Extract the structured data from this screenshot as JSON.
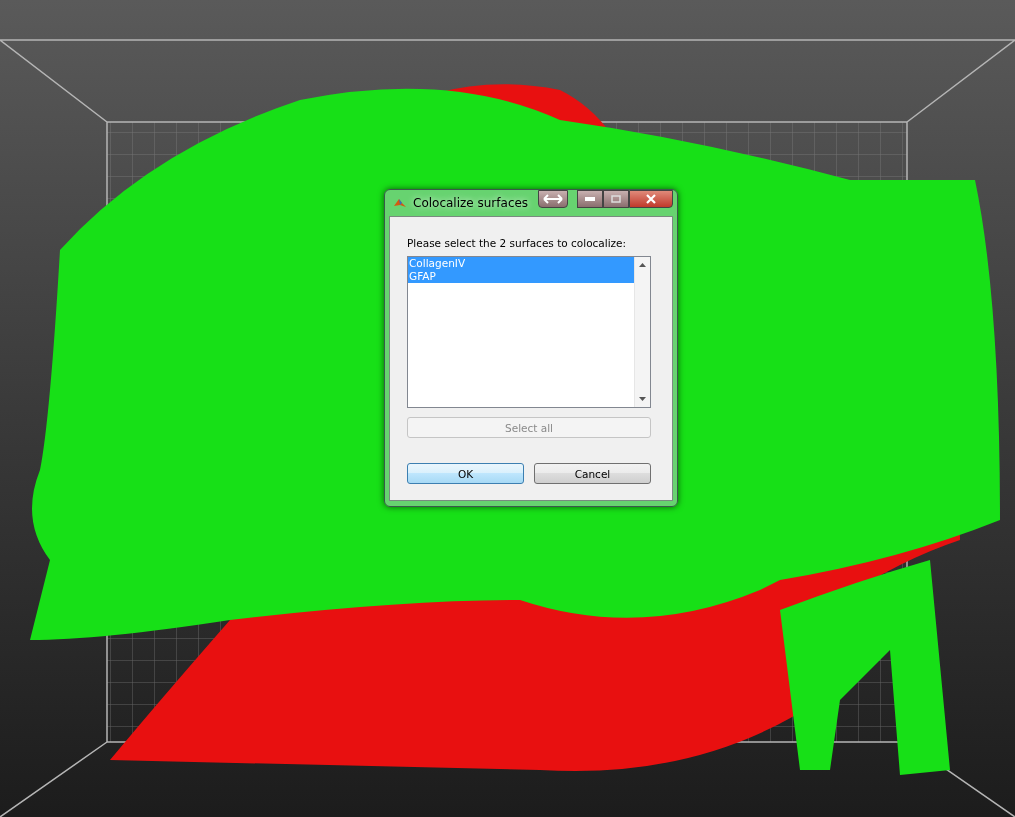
{
  "dialog": {
    "title": "Colocalize surfaces",
    "prompt": "Please select the 2 surfaces to colocalize:",
    "list": {
      "items": [
        {
          "label": "CollagenIV",
          "selected": true
        },
        {
          "label": "GFAP",
          "selected": true
        }
      ]
    },
    "buttons": [
      {
        "label": "Select all",
        "disabled": true,
        "default": false
      },
      {
        "label": "OK",
        "disabled": false,
        "default": true
      },
      {
        "label": "Cancel",
        "disabled": false,
        "default": false
      }
    ]
  }
}
